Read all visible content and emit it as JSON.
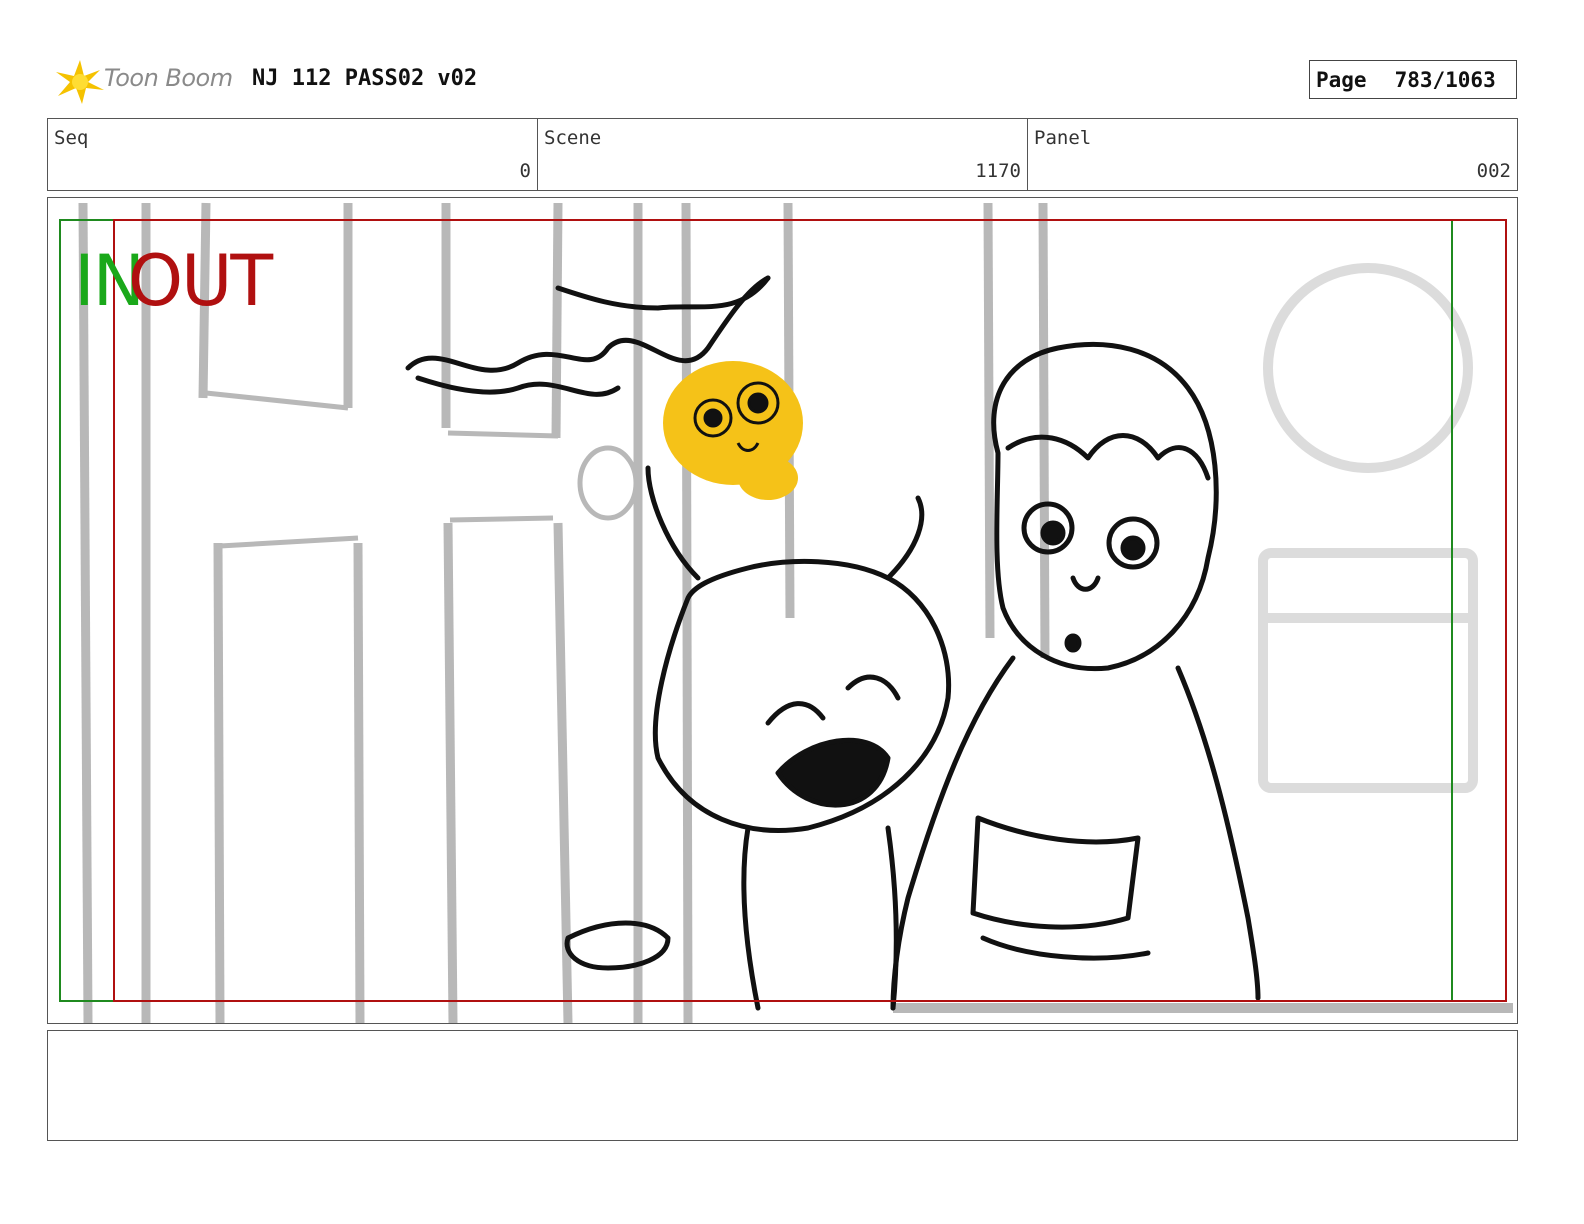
{
  "header": {
    "logo_text": "Toon Boom",
    "document_title": "NJ 112 PASS02 v02",
    "page_label": "Page",
    "page_value": "783/1063"
  },
  "info": {
    "seq_label": "Seq",
    "seq_value": "0",
    "scene_label": "Scene",
    "scene_value": "1170",
    "panel_label": "Panel",
    "panel_value": "002"
  },
  "panel": {
    "in_label": "IN",
    "out_label": "OUT",
    "in_color": "#1aa81a",
    "out_color": "#b01010"
  },
  "notes": {
    "text": ""
  }
}
